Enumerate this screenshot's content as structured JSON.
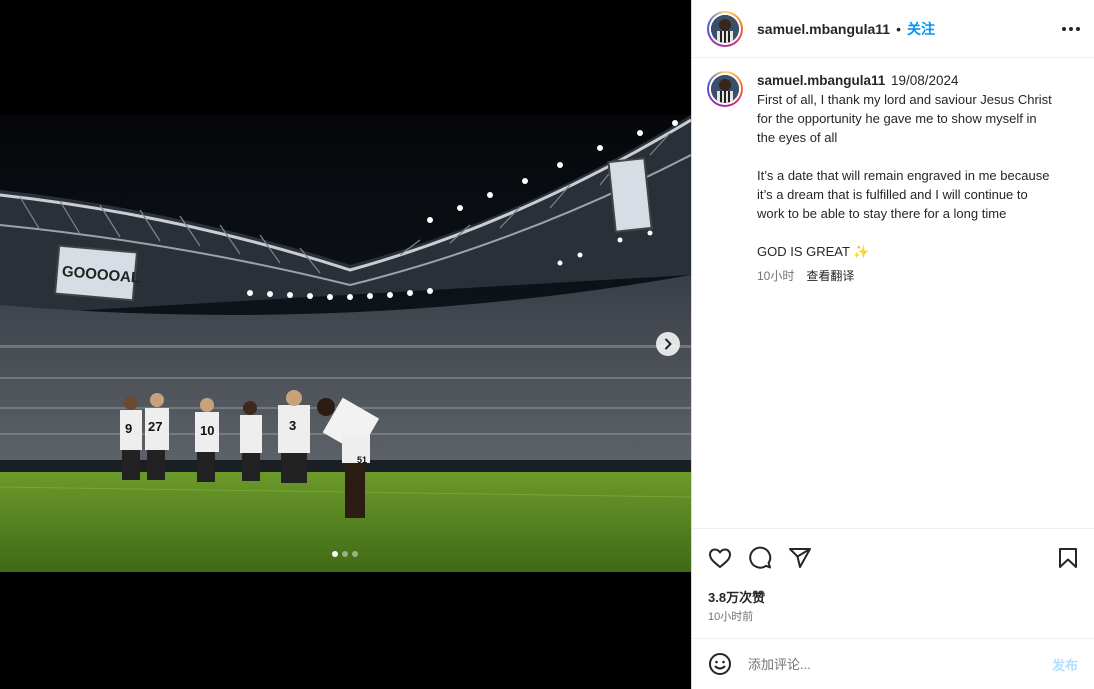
{
  "post": {
    "username": "samuel.mbangula11",
    "separator": "•",
    "follow_label": "关注",
    "caption_user": "samuel.mbangula11",
    "caption_date": "19/08/2024",
    "caption_p1": "First of all, I thank my lord and saviour Jesus Christ for the opportunity he gave me to show myself in the eyes of all",
    "caption_p2": "It’s a date that will remain engraved in me because it’s a dream that is fulfilled and I will continue to work to be able to stay there for a long time",
    "caption_p3": "GOD IS GREAT ✨",
    "caption_age": "10小时",
    "translate_label": "查看翻译",
    "likes": "3.8万次赞",
    "posted_ago": "10小时前"
  },
  "media": {
    "screen_text": "GOOOOAL",
    "slides": 3,
    "active_slide": 0
  },
  "comment": {
    "placeholder": "添加评论...",
    "post_label": "发布"
  },
  "icons": {
    "more": "more-horizontal-icon",
    "next": "chevron-right-icon",
    "like": "heart-icon",
    "comment": "comment-icon",
    "share": "paper-plane-icon",
    "save": "bookmark-icon",
    "emoji": "smiley-icon"
  },
  "colors": {
    "link_blue": "#0095f6",
    "post_disabled": "#b2dffc",
    "muted": "#737373"
  }
}
